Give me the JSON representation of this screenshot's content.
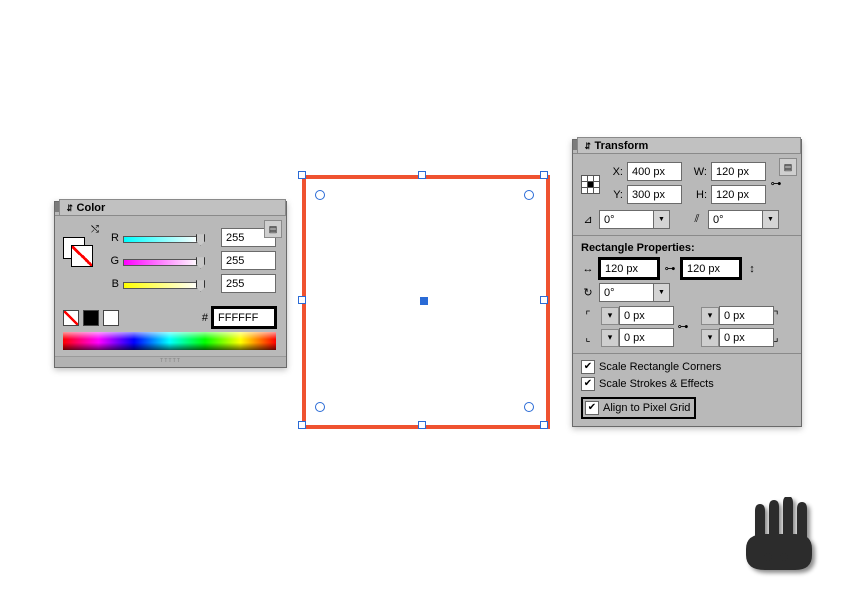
{
  "colorPanel": {
    "title": "Color",
    "channels": {
      "r": {
        "label": "R",
        "value": "255"
      },
      "g": {
        "label": "G",
        "value": "255"
      },
      "b": {
        "label": "B",
        "value": "255"
      }
    },
    "hexPrefix": "#",
    "hex": "FFFFFF"
  },
  "transformPanel": {
    "title": "Transform",
    "x": {
      "label": "X:",
      "value": "400 px"
    },
    "y": {
      "label": "Y:",
      "value": "300 px"
    },
    "w": {
      "label": "W:",
      "value": "120 px"
    },
    "h": {
      "label": "H:",
      "value": "120 px"
    },
    "rotate": "0°",
    "shear": "0°",
    "rectPropsTitle": "Rectangle Properties:",
    "rectW": "120 px",
    "rectH": "120 px",
    "rectRotate": "0°",
    "corners": {
      "tl": "0 px",
      "tr": "0 px",
      "bl": "0 px",
      "br": "0 px"
    },
    "scaleCorners": {
      "label": "Scale Rectangle Corners",
      "checked": true
    },
    "scaleStrokes": {
      "label": "Scale Strokes & Effects",
      "checked": true
    },
    "alignPixel": {
      "label": "Align to Pixel Grid",
      "checked": true
    }
  },
  "icons": {
    "collapse": "◂◂",
    "close": "×",
    "menu": "▤",
    "dropdown": "▼",
    "link": "⊶",
    "shear": "⫽",
    "angle": "⊿",
    "flipH": "⇋",
    "constrain": "⊟",
    "cornerTL": "⌜",
    "cornerTR": "⌝",
    "cornerBL": "⌞",
    "cornerBR": "⌟",
    "swap": "⤭",
    "none": "∅",
    "spin": "↻",
    "widthArrow": "↔",
    "heightArrow": "↕"
  },
  "trackGradients": {
    "r": [
      "#00ffff",
      "#ffffff"
    ],
    "g": [
      "#ff00ff",
      "#ffffff"
    ],
    "b": [
      "#ffff00",
      "#ffffff"
    ]
  }
}
